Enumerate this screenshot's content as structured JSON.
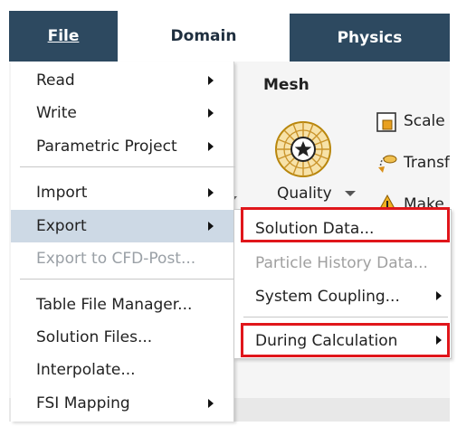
{
  "tabs": {
    "file": "File",
    "domain": "Domain",
    "physics": "Physics"
  },
  "ribbon": {
    "group_title": "Mesh",
    "quality_label": "Quality",
    "items": [
      "Scale",
      "Transform",
      "Make"
    ]
  },
  "file_menu": {
    "read": "Read",
    "write": "Write",
    "parametric_project": "Parametric Project",
    "import": "Import",
    "export": "Export",
    "export_to_cfd_post": "Export to CFD-Post...",
    "table_file_manager": "Table File Manager...",
    "solution_files": "Solution Files...",
    "interpolate": "Interpolate...",
    "fsi_mapping": "FSI Mapping"
  },
  "export_submenu": {
    "solution_data": "Solution Data...",
    "particle_history_data": "Particle History Data...",
    "system_coupling": "System Coupling...",
    "during_calculation": "During Calculation"
  },
  "colors": {
    "tab_dark": "#2d4960",
    "highlight": "#cdd9e5",
    "annotation_red": "#e0161b",
    "disabled_text": "#9aa0a6"
  }
}
